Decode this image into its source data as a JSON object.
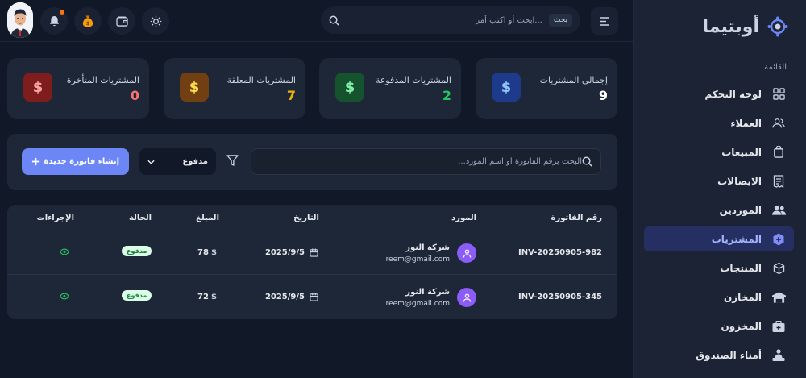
{
  "app": {
    "brand": "أوبتيما"
  },
  "sidebar": {
    "caption": "القائمة",
    "items": [
      {
        "label": "لوحة التحكم",
        "icon": "grid-icon"
      },
      {
        "label": "العملاء",
        "icon": "users-icon"
      },
      {
        "label": "المبيعات",
        "icon": "bag-icon"
      },
      {
        "label": "الايصالات",
        "icon": "receipt-icon"
      },
      {
        "label": "الموردين",
        "icon": "group-icon"
      },
      {
        "label": "المشتريات",
        "icon": "box-plus-icon"
      },
      {
        "label": "المنتجات",
        "icon": "cube-icon"
      },
      {
        "label": "المخازن",
        "icon": "warehouse-icon"
      },
      {
        "label": "المخزون",
        "icon": "inventory-icon"
      },
      {
        "label": "أمناء الصندوق",
        "icon": "cashier-icon"
      }
    ],
    "active_index": 5
  },
  "topbar": {
    "search_placeholder": "ابحث أو اكتب أمر...",
    "search_kbd": "بحث"
  },
  "stats": [
    {
      "title": "إجمالي المشتريات",
      "value": "9",
      "color": "#ffffff",
      "icon_bg": "#1e3a8a",
      "icon_color": "#93c5fd"
    },
    {
      "title": "المشتريات المدفوعة",
      "value": "2",
      "color": "#22c55e",
      "icon_bg": "#14532d",
      "icon_color": "#86efac"
    },
    {
      "title": "المشتريات المعلقة",
      "value": "7",
      "color": "#eab308",
      "icon_bg": "#713f12",
      "icon_color": "#fde047"
    },
    {
      "title": "المشتريات المتأخرة",
      "value": "0",
      "color": "#f87171",
      "icon_bg": "#7f1d1d",
      "icon_color": "#fca5a5"
    }
  ],
  "stat_icon_symbol": "$",
  "filters": {
    "search_placeholder": "البحث برقم الفاتورة أو اسم المورد...",
    "status_selected": "مدفوع",
    "create_label": "إنشاء فاتورة جديدة"
  },
  "table": {
    "headers": {
      "invoice": "رقم الفاتورة",
      "supplier": "المورد",
      "date": "التاريخ",
      "amount": "المبلغ",
      "status": "الحالة",
      "actions": "الإجراءات"
    },
    "rows": [
      {
        "invoice": "INV-20250905-982",
        "supplier": "شركة النور",
        "email": "reem@gmail.com",
        "date": "2025/9/5",
        "currency": "$",
        "amount": "78",
        "status": "مدفوع"
      },
      {
        "invoice": "INV-20250905-345",
        "supplier": "شركة النور",
        "email": "reem@gmail.com",
        "date": "2025/9/5",
        "currency": "$",
        "amount": "72",
        "status": "مدفوع"
      }
    ]
  }
}
